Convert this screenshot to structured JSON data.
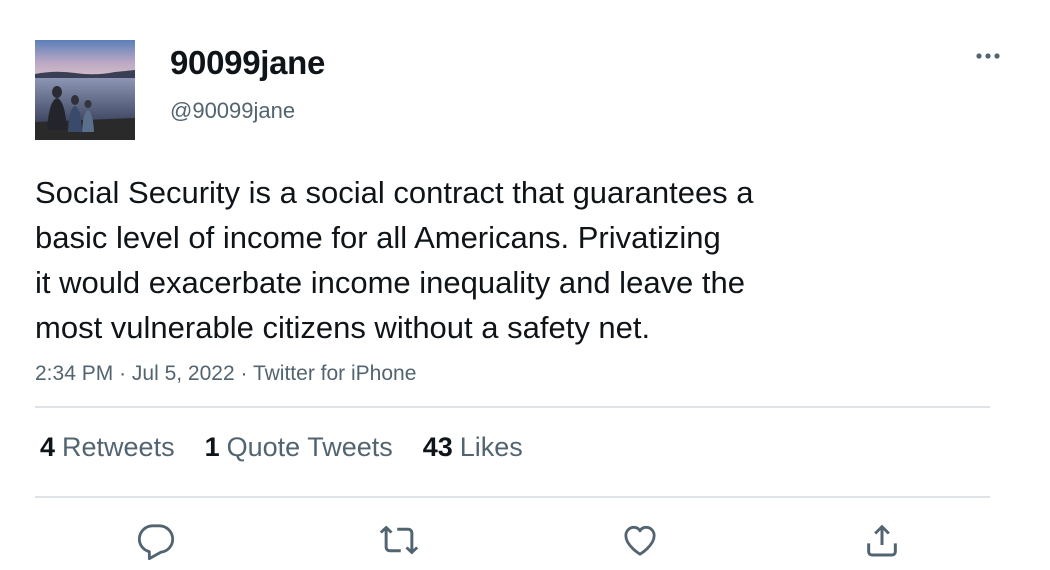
{
  "user": {
    "display_name": "90099jane",
    "handle": "@90099jane",
    "avatar_icon": "avatar-photo-lakeside-silhouettes"
  },
  "tweet": {
    "lines": [
      "Social Security is a social contract that guarantees a",
      "basic level of income for all Americans. Privatizing",
      "it would exacerbate income inequality and leave the",
      "most vulnerable citizens without a safety net."
    ],
    "time": "2:34 PM",
    "separator": "·",
    "date": "Jul 5, 2022",
    "source": "Twitter for iPhone"
  },
  "stats": {
    "retweets": {
      "count": "4",
      "label": "Retweets"
    },
    "quotes": {
      "count": "1",
      "label": "Quote Tweets"
    },
    "likes": {
      "count": "43",
      "label": "Likes"
    }
  },
  "actions": [
    {
      "icon": "reply-icon"
    },
    {
      "icon": "retweet-icon"
    },
    {
      "icon": "like-heart-icon"
    },
    {
      "icon": "share-icon"
    }
  ],
  "colors": {
    "text_primary": "#0f1419",
    "text_secondary": "#536471",
    "divider": "#dfe3e6"
  }
}
